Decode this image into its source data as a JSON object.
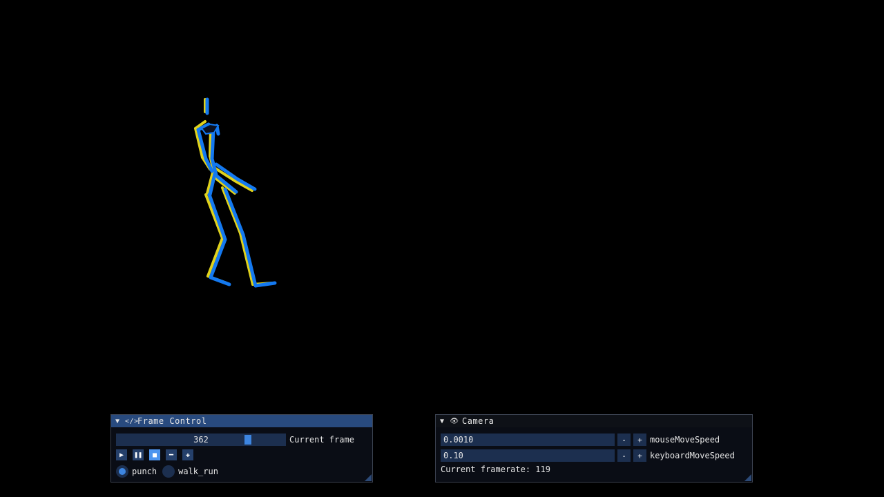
{
  "viewport": {
    "background": "#000000",
    "skeleton_colors": {
      "primary": "#1479f0",
      "secondary": "#e0d21c"
    }
  },
  "frame_control": {
    "title": "Frame Control",
    "collapse_icon": "triangle-down-icon",
    "title_icon": "code-icon",
    "slider": {
      "value": "362",
      "label": "Current frame",
      "fraction": 0.79
    },
    "buttons": [
      {
        "name": "play-button",
        "icon": "play-icon",
        "glyph": "▶",
        "active": false
      },
      {
        "name": "pause-button",
        "icon": "pause-icon",
        "glyph": "❚❚",
        "active": false
      },
      {
        "name": "stop-button",
        "icon": "stop-icon",
        "glyph": "■",
        "active": true
      },
      {
        "name": "step-back-button",
        "icon": "minus-icon",
        "glyph": "━",
        "active": false
      },
      {
        "name": "step-forward-button",
        "icon": "plus-icon",
        "glyph": "✚",
        "active": false
      }
    ],
    "animations": [
      {
        "label": "punch",
        "selected": true
      },
      {
        "label": "walk_run",
        "selected": false
      }
    ]
  },
  "camera": {
    "title": "Camera",
    "collapse_icon": "triangle-down-icon",
    "title_icon": "eye-icon",
    "fields": [
      {
        "value": "0.0010",
        "label": "mouseMoveSpeed",
        "minus": "-",
        "plus": "+"
      },
      {
        "value": "0.10",
        "label": "keyboardMoveSpeed",
        "minus": "-",
        "plus": "+"
      }
    ],
    "framerate_text": "Current framerate: 119"
  }
}
